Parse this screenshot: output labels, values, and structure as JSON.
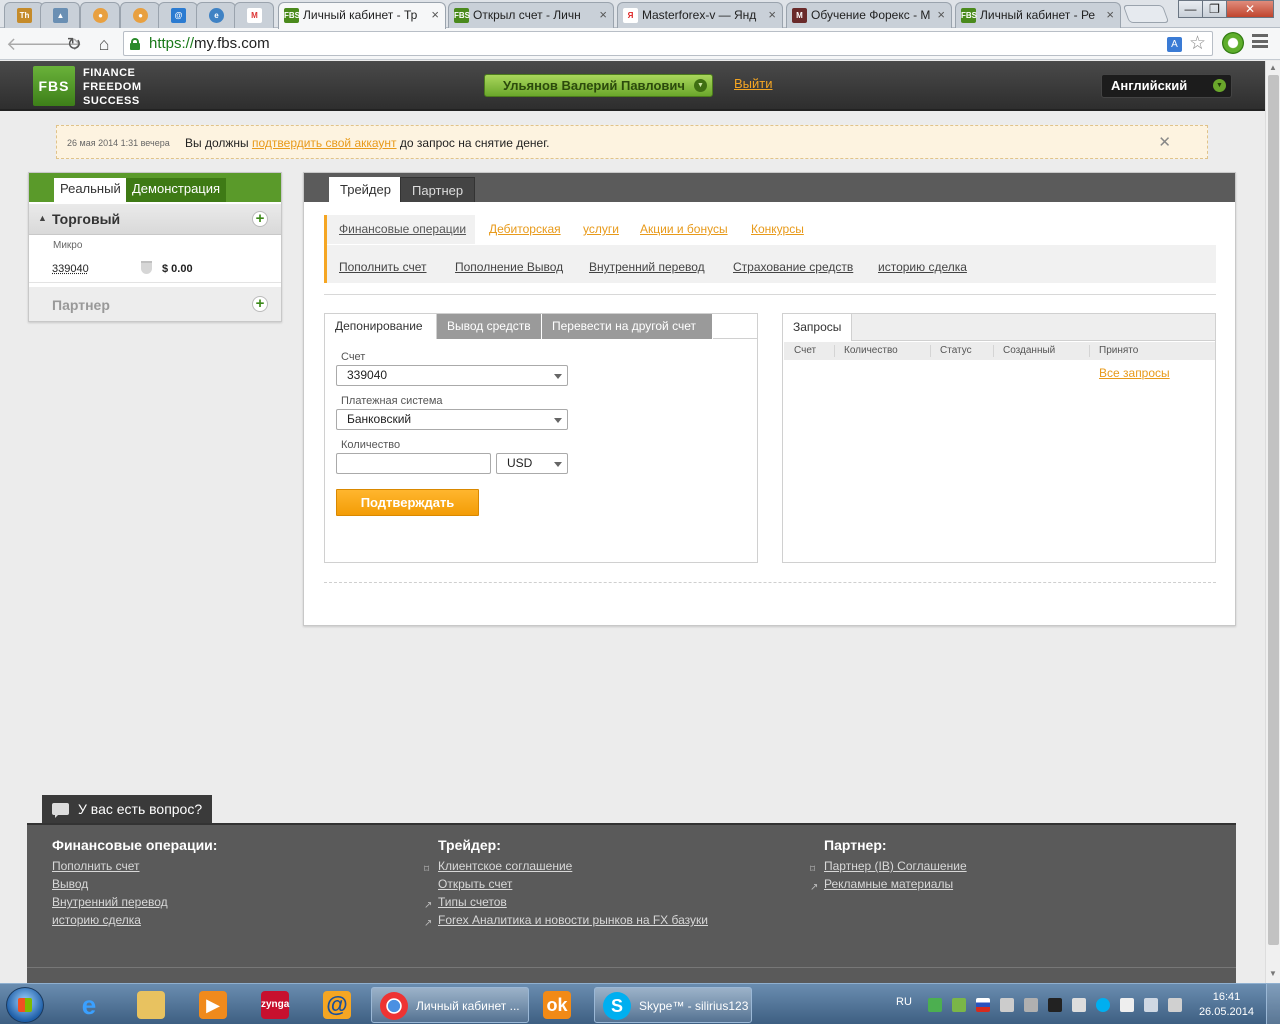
{
  "browser": {
    "tabs": [
      {
        "title": "",
        "favicon": "Th",
        "color": "#c58b2a",
        "pinned": true
      },
      {
        "title": "",
        "favicon": "▲",
        "color": "#6a8fb3",
        "pinned": true
      },
      {
        "title": "",
        "favicon": "●",
        "color": "#e8a040",
        "pinned": true
      },
      {
        "title": "",
        "favicon": "●",
        "color": "#e8a040",
        "pinned": true
      },
      {
        "title": "",
        "favicon": "@",
        "color": "#2b7bd1",
        "pinned": true
      },
      {
        "title": "",
        "favicon": "e",
        "color": "#3f82c4",
        "pinned": true
      },
      {
        "title": "",
        "favicon": "M",
        "color": "#d33",
        "pinned": true
      },
      {
        "title": "Личный кабинет - Тр",
        "favicon": "FBS",
        "color": "#4a8a1c",
        "pinned": false,
        "active": true
      },
      {
        "title": "Открыл счет - Личн",
        "favicon": "FBS",
        "color": "#4a8a1c",
        "pinned": false
      },
      {
        "title": "Masterforex-v — Янд",
        "favicon": "Я",
        "color": "#d22",
        "pinned": false
      },
      {
        "title": "Обучение Форекс - М",
        "favicon": "M",
        "color": "#6a2a2a",
        "pinned": false
      },
      {
        "title": "Личный кабинет - Ре",
        "favicon": "FBS",
        "color": "#4a8a1c",
        "pinned": false
      }
    ],
    "close_glyph": "×",
    "window_controls": {
      "minimize": "—",
      "maximize": "❐",
      "close": "✕"
    },
    "url_scheme": "https://",
    "url_host": "my.fbs.com"
  },
  "site": {
    "logo_mark": "FBS",
    "logo_lines": [
      "FINANCE",
      "FREEDOM",
      "SUCCESS"
    ],
    "user_name": "Ульянов Валерий Павлович",
    "logout": "Выйти",
    "language": "Английский",
    "chevron": "▼"
  },
  "notice": {
    "date": "26 мая 2014 1:31 вечера",
    "text_before": "Вы должны ",
    "link": "подтвердить свой аккаунт",
    "text_after": " до запрос на снятие денег.",
    "close": "✕"
  },
  "accounts": {
    "tab_real": "Реальный",
    "tab_demo": "Демонстрация",
    "section_trading": "Торговый",
    "type": "Микро",
    "account_number": "339040",
    "balance": "$  0.00",
    "section_partner": "Партнер",
    "plus": "+",
    "arrow": "▲"
  },
  "main": {
    "tab_trader": "Трейдер",
    "tab_partner": "Партнер",
    "subnav_top": [
      {
        "label": "Финансовые операции",
        "active": true
      },
      {
        "label": "Дебиторская"
      },
      {
        "label": "услуги"
      },
      {
        "label": "Акции и бонусы"
      },
      {
        "label": "Конкурсы"
      }
    ],
    "subnav_bottom": [
      "Пополнить счет ",
      "Пополнение Вывод ",
      "Внутренний перевод ",
      "Страхование средств ",
      "историю сделка"
    ],
    "form": {
      "tabs": [
        "Депонирование",
        "Вывод средств",
        "Перевести на другой счет"
      ],
      "account_label": "Счет",
      "account_value": "339040",
      "payment_label": "Платежная система",
      "payment_value": "Банковский",
      "amount_label": "Количество",
      "amount_value": "",
      "currency": "USD",
      "submit": "Подтверждать"
    },
    "requests": {
      "tab": "Запросы",
      "columns": [
        "Счет",
        "Количество",
        "Статус",
        "Созданный",
        "Принято"
      ],
      "all_link": "Все запросы"
    }
  },
  "help": {
    "label": "У вас есть вопрос?"
  },
  "footer": {
    "col1_title": "Финансовые операции:",
    "col1_links": [
      "Пополнить счет",
      "Вывод",
      "Внутренний перевод",
      "историю сделка"
    ],
    "col2_title": "Трейдер:",
    "col2_links": [
      "Клиентское соглашение",
      "Открыть счет",
      "Типы счетов",
      "Forex Аналитика и новости рынков на FX базуки"
    ],
    "col3_title": "Партнер:",
    "col3_links": [
      "Партнер (IB) Соглашение",
      "Рекламные материалы"
    ]
  },
  "taskbar": {
    "tasks": [
      {
        "label": "Личный кабинет ..."
      },
      {
        "label": "Skype™ - silirius123"
      }
    ],
    "pinned_app_names": [
      "ie-icon",
      "explorer-icon",
      "media-player-icon",
      "zynga-icon",
      "mail-icon",
      "odnoklassniki-icon"
    ],
    "lang": "RU",
    "time": "16:41",
    "date": "26.05.2014"
  }
}
